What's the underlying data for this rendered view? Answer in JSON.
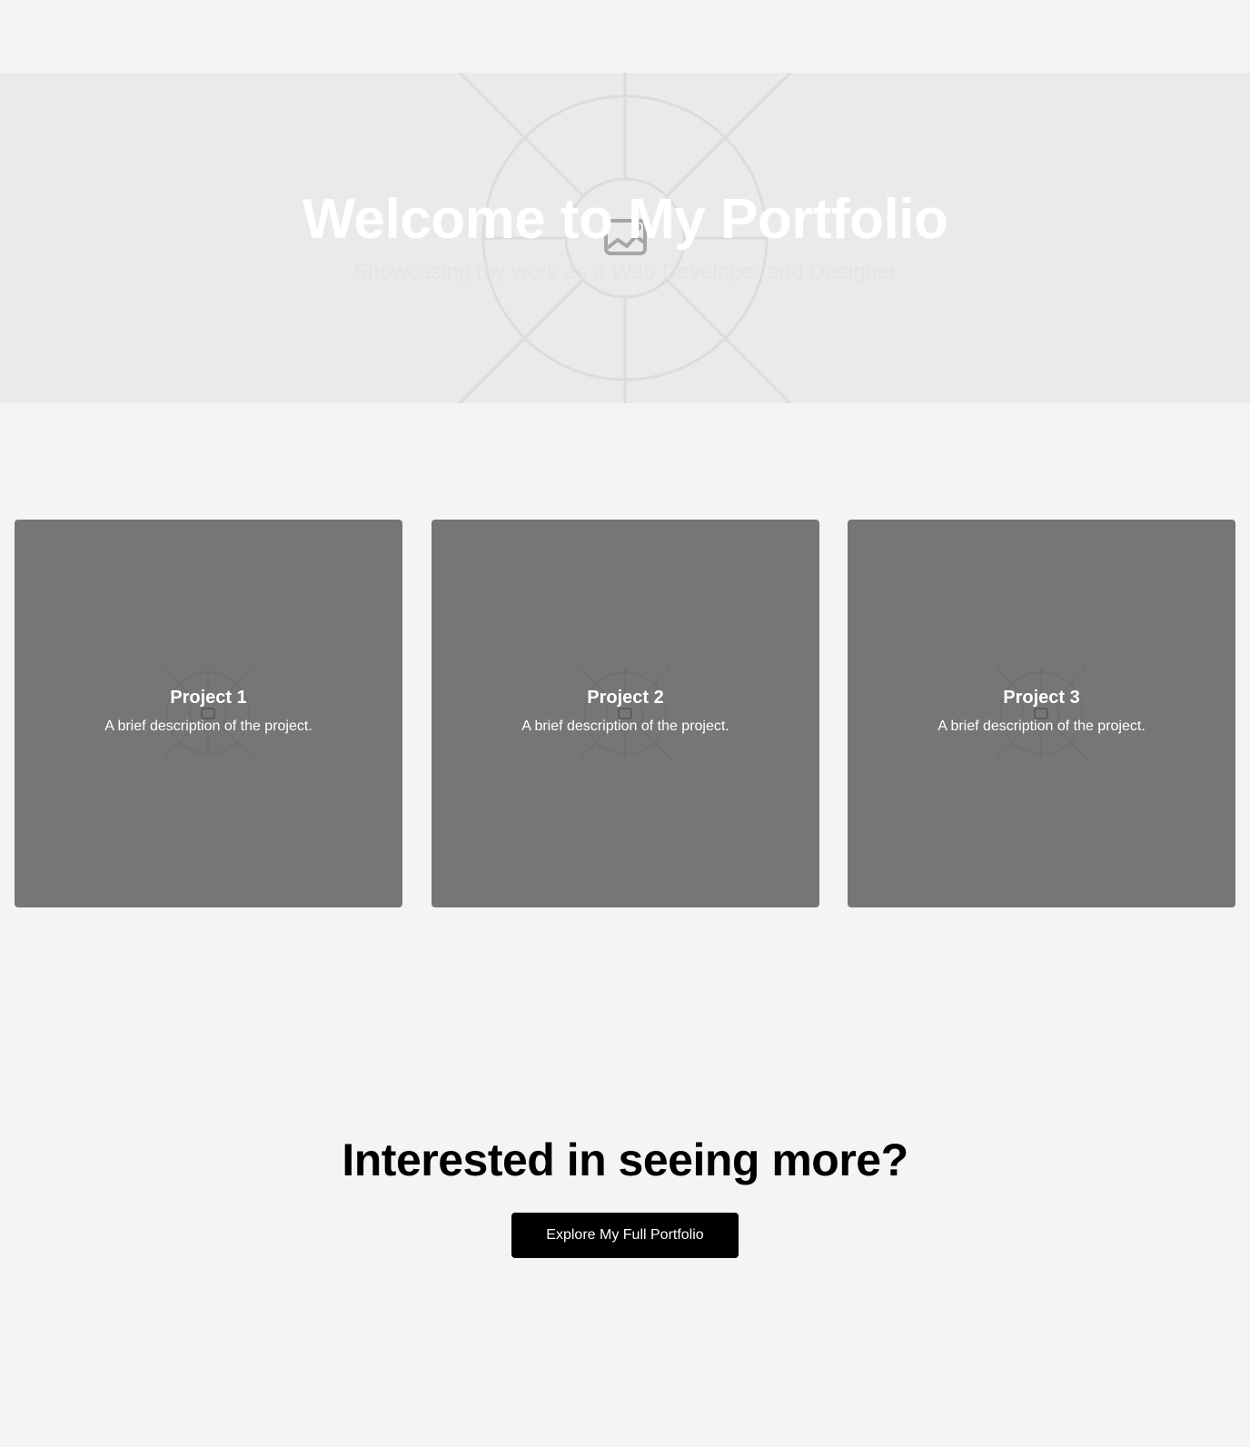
{
  "hero": {
    "title": "Welcome to My Portfolio",
    "subtitle": "Showcasing my work as a Web Developer and Designer",
    "background_icon": "image-placeholder-icon"
  },
  "projects": [
    {
      "title": "Project 1",
      "description": "A brief description of the project.",
      "icon": "image-placeholder-icon"
    },
    {
      "title": "Project 2",
      "description": "A brief description of the project.",
      "icon": "image-placeholder-icon"
    },
    {
      "title": "Project 3",
      "description": "A brief description of the project.",
      "icon": "image-placeholder-icon"
    }
  ],
  "cta": {
    "heading": "Interested in seeing more?",
    "button_label": "Explore My Full Portfolio"
  },
  "colors": {
    "page_bg": "#f3f4f6",
    "hero_bg": "#eaeaea",
    "card_bg": "#767676",
    "button_bg": "#000000",
    "button_text": "#ffffff"
  }
}
